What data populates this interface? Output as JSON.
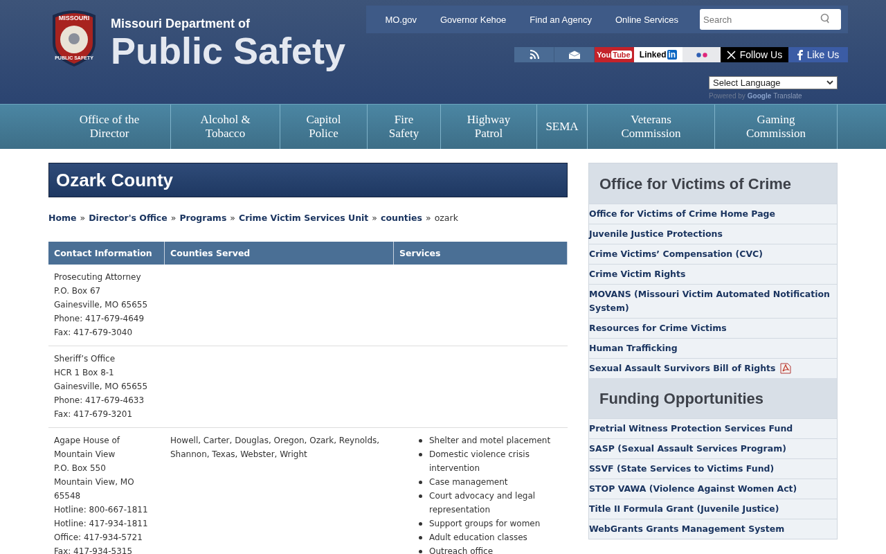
{
  "header": {
    "seal_top": "MISSOURI",
    "seal_bottom": "PUBLIC SAFETY",
    "title_small": "Missouri Department of",
    "title_large": "Public Safety"
  },
  "top_links": [
    "MO.gov",
    "Governor Kehoe",
    "Find an Agency",
    "Online Services"
  ],
  "search": {
    "placeholder": "Search"
  },
  "social": [
    {
      "kind": "rss"
    },
    {
      "kind": "email"
    },
    {
      "kind": "youtube",
      "text": "You",
      "text2": "Tube"
    },
    {
      "kind": "linkedin",
      "text": "Linked",
      "text2": "in"
    },
    {
      "kind": "flickr"
    },
    {
      "kind": "x",
      "label": "Follow Us"
    },
    {
      "kind": "facebook",
      "label": "Like Us"
    }
  ],
  "language": {
    "value": "Select Language",
    "powered_by": "Powered by",
    "google": "Google",
    "translate": "Translate"
  },
  "nav": [
    "Office of the Director",
    "Alcohol & Tobacco",
    "Capitol Police",
    "Fire Safety",
    "Highway Patrol",
    "SEMA",
    "Veterans Commission",
    "Gaming Commission"
  ],
  "page_title": "Ozark County",
  "breadcrumb": {
    "separator": "»",
    "items": [
      {
        "label": "Home",
        "link": true
      },
      {
        "label": "Director's Office",
        "link": true
      },
      {
        "label": "Programs",
        "link": true
      },
      {
        "label": "Crime Victim Services Unit",
        "link": true
      },
      {
        "label": "counties",
        "link": true
      },
      {
        "label": "ozark",
        "link": false
      }
    ]
  },
  "table": {
    "columns": [
      "Contact Information",
      "Counties Served",
      "Services"
    ],
    "rows": [
      {
        "contact": [
          "Prosecuting Attorney",
          "P.O. Box 67",
          "Gainesville, MO 65655",
          "Phone: 417-679-4649",
          "Fax: 417-679-3040"
        ]
      },
      {
        "contact": [
          "Sheriff’s Office",
          "HCR 1 Box 8-1",
          "Gainesville, MO 65655",
          "Phone: 417-679-4633",
          "Fax: 417-679-3201"
        ]
      },
      {
        "contact": [
          "Agape House of Mountain View",
          "P.O. Box 550",
          "Mountain View, MO 65548",
          "Hotline: 800-667-1811",
          "Hotline: 417-934-1811",
          "Office: 417-934-5721",
          "Fax: 417-934-5315"
        ],
        "counties": "Howell, Carter, Douglas, Oregon, Ozark, Reynolds, Shannon, Texas, Webster, Wright",
        "services": [
          "Shelter and motel placement",
          "Domestic violence crisis intervention",
          "Case management",
          "Court advocacy and legal representation",
          "Support groups for women",
          "Adult education classes",
          "Outreach office"
        ]
      }
    ]
  },
  "sidebar": [
    {
      "heading": "Office for Victims of Crime",
      "links": [
        {
          "label": "Office for Victims of Crime Home Page",
          "pdf": false
        },
        {
          "label": "Juvenile Justice Protections",
          "pdf": false
        },
        {
          "label": "Crime Victims’ Compensation (CVC)",
          "pdf": false
        },
        {
          "label": "Crime Victim Rights",
          "pdf": false
        },
        {
          "label": "MOVANS (Missouri Victim Automated Notification System)",
          "pdf": false
        },
        {
          "label": "Resources for Crime Victims",
          "pdf": false
        },
        {
          "label": "Human Trafficking",
          "pdf": false
        },
        {
          "label": "Sexual Assault Survivors Bill of Rights",
          "pdf": true
        }
      ]
    },
    {
      "heading": "Funding Opportunities",
      "links": [
        {
          "label": "Pretrial Witness Protection Services Fund",
          "pdf": false
        },
        {
          "label": "SASP (Sexual Assault Services Program)",
          "pdf": false
        },
        {
          "label": "SSVF (State Services to Victims Fund)",
          "pdf": false
        },
        {
          "label": "STOP VAWA (Violence Against Women Act)",
          "pdf": false
        },
        {
          "label": "Title II Formula Grant (Juvenile Justice)",
          "pdf": false
        },
        {
          "label": "WebGrants Grants Management System",
          "pdf": false
        }
      ]
    }
  ]
}
